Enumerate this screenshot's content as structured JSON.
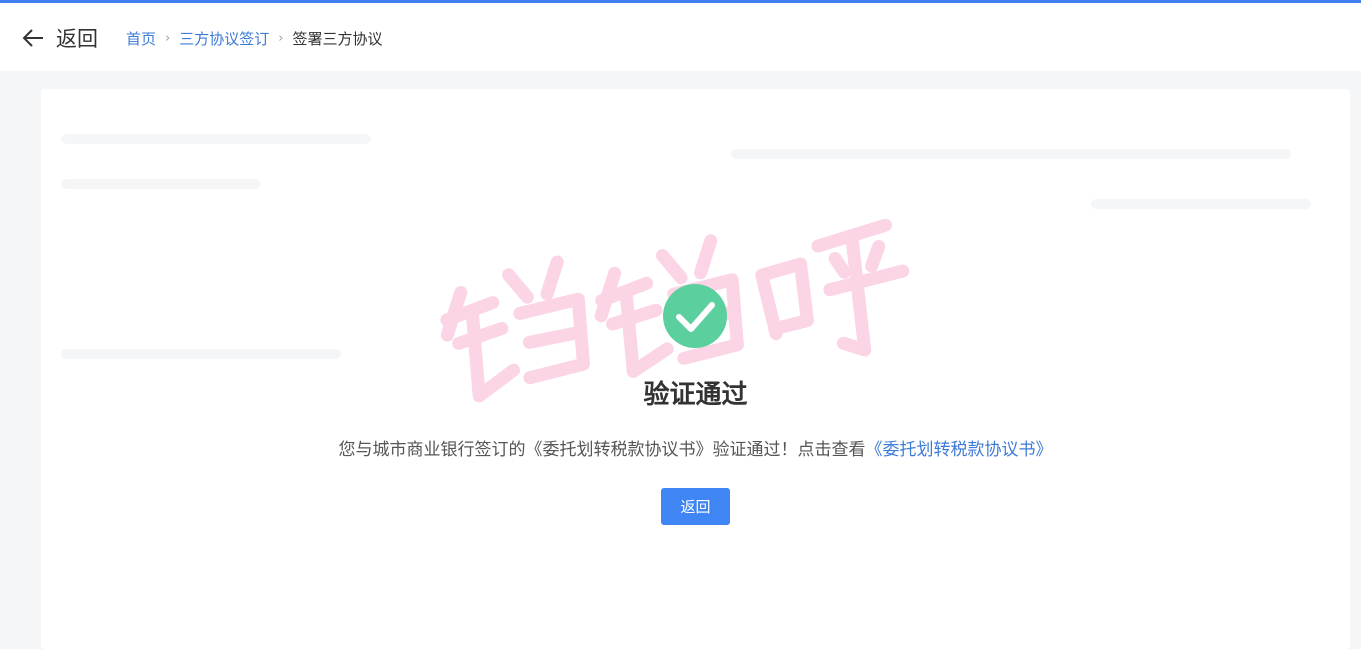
{
  "colors": {
    "accent": "#3f7ff0",
    "link": "#3d7bd8",
    "success": "#5ccf9f",
    "watermark": "#fbd4e6",
    "button": "#3f85f3"
  },
  "header": {
    "back_icon": "arrow-left-icon",
    "back_label": "返回",
    "breadcrumb": {
      "items": [
        "首页",
        "三方协议签订"
      ],
      "current": "签署三方协议",
      "separator_icon": "chevron-right-icon"
    }
  },
  "result": {
    "icon": "check-circle-icon",
    "title": "验证通过",
    "desc_prefix": "您与城市商业银行签订的《委托划转税款协议书》验证通过！点击查看",
    "desc_link": "《委托划转税款协议书》",
    "button_label": "返回"
  },
  "watermark": {
    "text": "铛铛呀"
  }
}
